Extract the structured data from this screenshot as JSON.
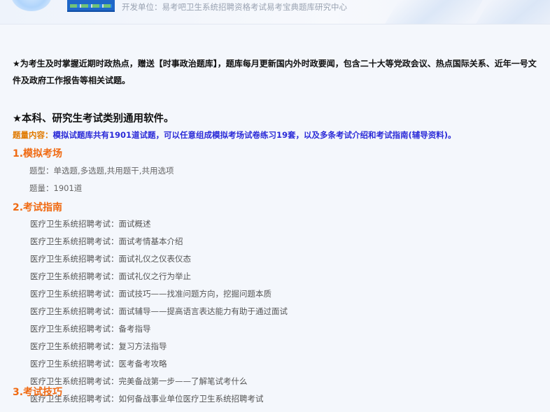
{
  "header": {
    "developer_text": "开发单位：易考吧卫生系统招聘资格考试易考宝典题库研究中心"
  },
  "notice": "★为考生及时掌握近期时政热点，赠送【时事政治题库】，题库每月更新国内外时政要闻，包含二十大等党政会议、热点国际关系、近年一号文件及政府工作报告等相关试题。",
  "section_title": "★本科、研究生考试类别通用软件。",
  "summary": {
    "label": "题量内容：",
    "text": "模拟试题库共有1901道试题，可以任意组成模拟考场试卷练习19套，以及多条考试介绍和考试指南(辅导资料)。"
  },
  "mock_exam": {
    "title": "1.模拟考场",
    "question_types": "题型：单选题,多选题,共用题干,共用选项",
    "question_count": "题量：1901道"
  },
  "exam_guide": {
    "title": "2.考试指南",
    "prefix": "医疗卫生系统招聘考试：",
    "items": [
      "面试概述",
      "面试考情基本介绍",
      "面试礼仪之仪表仪态",
      "面试礼仪之行为举止",
      "面试技巧——找准问题方向，挖掘问题本质",
      "面试辅导——提高语言表达能力有助于通过面试",
      "备考指导",
      "复习方法指导",
      "医考备考攻略",
      "完美备战第一步——了解笔试考什么",
      "如何备战事业单位医疗卫生系统招聘考试"
    ]
  },
  "next_section_title": "3.考试技巧"
}
